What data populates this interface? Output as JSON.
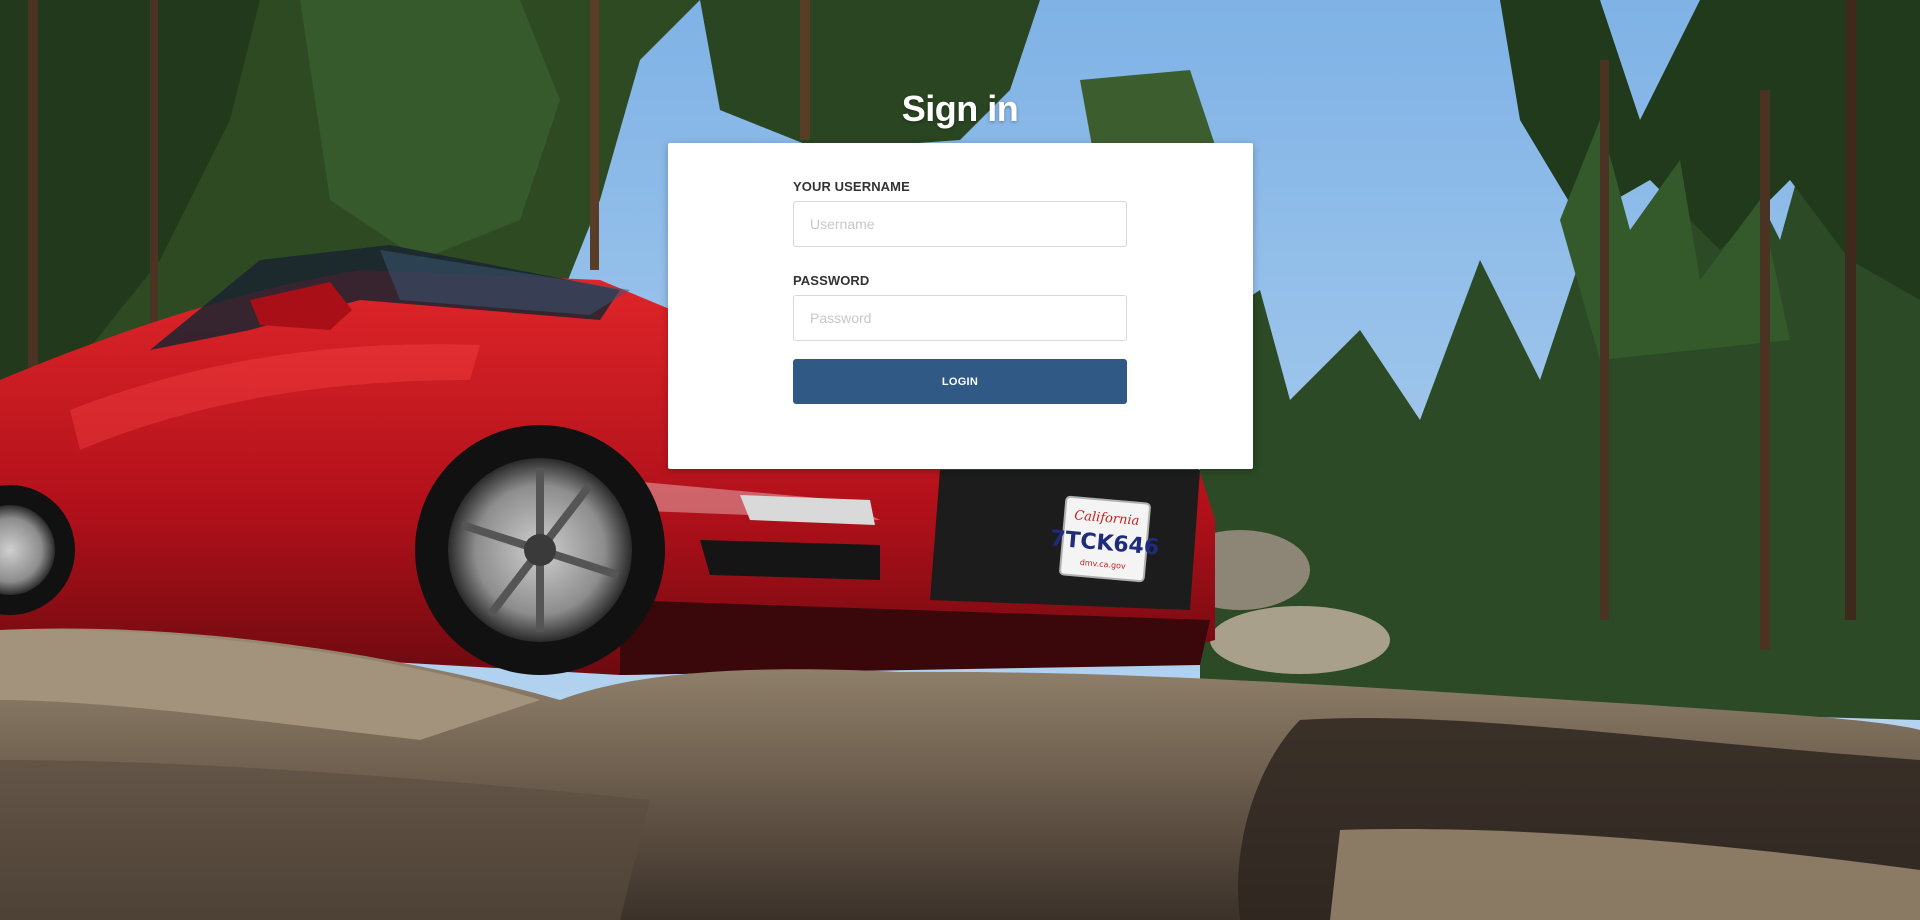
{
  "page": {
    "title": "Sign in"
  },
  "form": {
    "username": {
      "label": "YOUR USERNAME",
      "placeholder": "Username",
      "value": ""
    },
    "password": {
      "label": "PASSWORD",
      "placeholder": "Password",
      "value": ""
    },
    "login_label": "LOGIN"
  },
  "background": {
    "plate_state": "California",
    "plate_number": "7TCK646",
    "plate_site": "dmv.ca.gov",
    "colors": {
      "sky": "#9cc3e8",
      "car": "#c8141a",
      "rock": "#8a7a66",
      "trees": "#2b4a25"
    }
  },
  "colors": {
    "button": "#305a85",
    "card": "#ffffff",
    "heading": "#ffffff"
  }
}
